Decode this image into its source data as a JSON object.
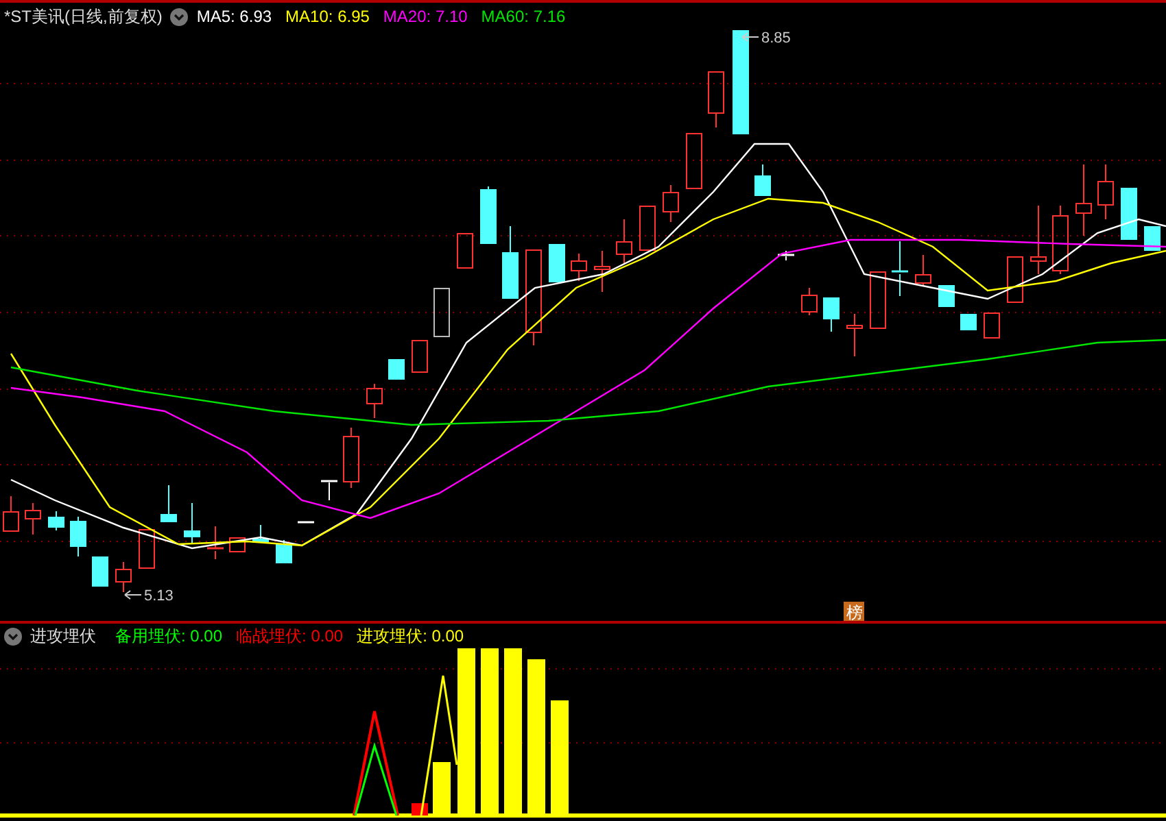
{
  "main_panel": {
    "title": "*ST美讯(日线,前复权)",
    "indicators": [
      {
        "label": "MA5:",
        "value": "6.93",
        "color": "#ffffff"
      },
      {
        "label": "MA10:",
        "value": "6.95",
        "color": "#ffff00"
      },
      {
        "label": "MA20:",
        "value": "7.10",
        "color": "#ff00ff"
      },
      {
        "label": "MA60:",
        "value": "7.16",
        "color": "#00e600"
      }
    ],
    "high_label": "8.85",
    "low_label": "5.13",
    "badge": "榜"
  },
  "sub_panel": {
    "title": "进攻埋伏",
    "indicators": [
      {
        "label": "备用埋伏:",
        "value": "0.00",
        "color": "#00ff00"
      },
      {
        "label": "临战埋伏:",
        "value": "0.00",
        "color": "#ff0000"
      },
      {
        "label": "进攻埋伏:",
        "value": "0.00",
        "color": "#ffff00"
      }
    ]
  }
}
